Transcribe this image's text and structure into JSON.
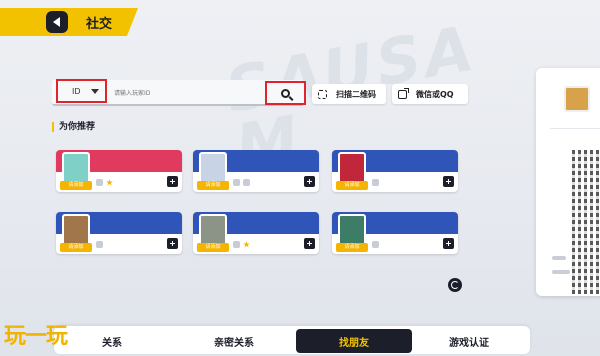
{
  "header": {
    "title": "社交"
  },
  "search": {
    "type_select_value": "ID",
    "placeholder": "请输入玩家ID",
    "scan_qr_label": "扫描二维码",
    "wechat_qq_label": "微信或QQ"
  },
  "recommend": {
    "section_title": "为你推荐",
    "cards": [
      {
        "badge": "请添加",
        "band_color": "#e03a5e",
        "avatar_color": "#7fd1c7"
      },
      {
        "badge": "请添加",
        "band_color": "#2f55b8",
        "avatar_color": "#c9d3e6"
      },
      {
        "badge": "请添加",
        "band_color": "#2f55b8",
        "avatar_color": "#c0273a"
      },
      {
        "badge": "请添加",
        "band_color": "#2f55b8",
        "avatar_color": "#a0764a"
      },
      {
        "badge": "请添加",
        "band_color": "#2f55b8",
        "avatar_color": "#8c9488"
      },
      {
        "badge": "请添加",
        "band_color": "#2f55b8",
        "avatar_color": "#3d7c66"
      }
    ]
  },
  "tabs": [
    {
      "label": "关系"
    },
    {
      "label": "亲密关系"
    },
    {
      "label": "找朋友",
      "active": true
    },
    {
      "label": "游戏认证"
    }
  ],
  "brand": {
    "text": "玩一玩"
  },
  "colors": {
    "accent": "#f2c200",
    "dark": "#1c1f2a",
    "highlight_box": "#e0242e"
  }
}
